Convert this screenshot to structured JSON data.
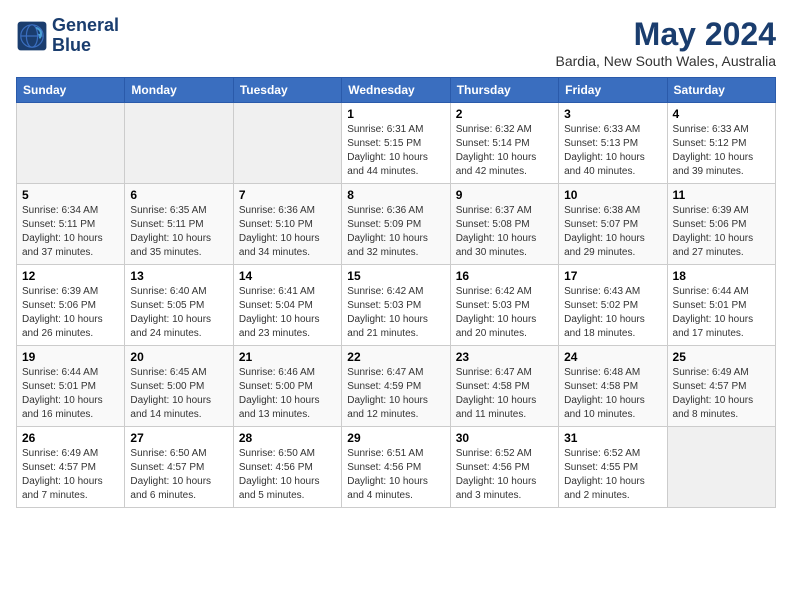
{
  "header": {
    "logo_line1": "General",
    "logo_line2": "Blue",
    "month_year": "May 2024",
    "location": "Bardia, New South Wales, Australia"
  },
  "days_of_week": [
    "Sunday",
    "Monday",
    "Tuesday",
    "Wednesday",
    "Thursday",
    "Friday",
    "Saturday"
  ],
  "weeks": [
    [
      {
        "num": "",
        "info": ""
      },
      {
        "num": "",
        "info": ""
      },
      {
        "num": "",
        "info": ""
      },
      {
        "num": "1",
        "info": "Sunrise: 6:31 AM\nSunset: 5:15 PM\nDaylight: 10 hours\nand 44 minutes."
      },
      {
        "num": "2",
        "info": "Sunrise: 6:32 AM\nSunset: 5:14 PM\nDaylight: 10 hours\nand 42 minutes."
      },
      {
        "num": "3",
        "info": "Sunrise: 6:33 AM\nSunset: 5:13 PM\nDaylight: 10 hours\nand 40 minutes."
      },
      {
        "num": "4",
        "info": "Sunrise: 6:33 AM\nSunset: 5:12 PM\nDaylight: 10 hours\nand 39 minutes."
      }
    ],
    [
      {
        "num": "5",
        "info": "Sunrise: 6:34 AM\nSunset: 5:11 PM\nDaylight: 10 hours\nand 37 minutes."
      },
      {
        "num": "6",
        "info": "Sunrise: 6:35 AM\nSunset: 5:11 PM\nDaylight: 10 hours\nand 35 minutes."
      },
      {
        "num": "7",
        "info": "Sunrise: 6:36 AM\nSunset: 5:10 PM\nDaylight: 10 hours\nand 34 minutes."
      },
      {
        "num": "8",
        "info": "Sunrise: 6:36 AM\nSunset: 5:09 PM\nDaylight: 10 hours\nand 32 minutes."
      },
      {
        "num": "9",
        "info": "Sunrise: 6:37 AM\nSunset: 5:08 PM\nDaylight: 10 hours\nand 30 minutes."
      },
      {
        "num": "10",
        "info": "Sunrise: 6:38 AM\nSunset: 5:07 PM\nDaylight: 10 hours\nand 29 minutes."
      },
      {
        "num": "11",
        "info": "Sunrise: 6:39 AM\nSunset: 5:06 PM\nDaylight: 10 hours\nand 27 minutes."
      }
    ],
    [
      {
        "num": "12",
        "info": "Sunrise: 6:39 AM\nSunset: 5:06 PM\nDaylight: 10 hours\nand 26 minutes."
      },
      {
        "num": "13",
        "info": "Sunrise: 6:40 AM\nSunset: 5:05 PM\nDaylight: 10 hours\nand 24 minutes."
      },
      {
        "num": "14",
        "info": "Sunrise: 6:41 AM\nSunset: 5:04 PM\nDaylight: 10 hours\nand 23 minutes."
      },
      {
        "num": "15",
        "info": "Sunrise: 6:42 AM\nSunset: 5:03 PM\nDaylight: 10 hours\nand 21 minutes."
      },
      {
        "num": "16",
        "info": "Sunrise: 6:42 AM\nSunset: 5:03 PM\nDaylight: 10 hours\nand 20 minutes."
      },
      {
        "num": "17",
        "info": "Sunrise: 6:43 AM\nSunset: 5:02 PM\nDaylight: 10 hours\nand 18 minutes."
      },
      {
        "num": "18",
        "info": "Sunrise: 6:44 AM\nSunset: 5:01 PM\nDaylight: 10 hours\nand 17 minutes."
      }
    ],
    [
      {
        "num": "19",
        "info": "Sunrise: 6:44 AM\nSunset: 5:01 PM\nDaylight: 10 hours\nand 16 minutes."
      },
      {
        "num": "20",
        "info": "Sunrise: 6:45 AM\nSunset: 5:00 PM\nDaylight: 10 hours\nand 14 minutes."
      },
      {
        "num": "21",
        "info": "Sunrise: 6:46 AM\nSunset: 5:00 PM\nDaylight: 10 hours\nand 13 minutes."
      },
      {
        "num": "22",
        "info": "Sunrise: 6:47 AM\nSunset: 4:59 PM\nDaylight: 10 hours\nand 12 minutes."
      },
      {
        "num": "23",
        "info": "Sunrise: 6:47 AM\nSunset: 4:58 PM\nDaylight: 10 hours\nand 11 minutes."
      },
      {
        "num": "24",
        "info": "Sunrise: 6:48 AM\nSunset: 4:58 PM\nDaylight: 10 hours\nand 10 minutes."
      },
      {
        "num": "25",
        "info": "Sunrise: 6:49 AM\nSunset: 4:57 PM\nDaylight: 10 hours\nand 8 minutes."
      }
    ],
    [
      {
        "num": "26",
        "info": "Sunrise: 6:49 AM\nSunset: 4:57 PM\nDaylight: 10 hours\nand 7 minutes."
      },
      {
        "num": "27",
        "info": "Sunrise: 6:50 AM\nSunset: 4:57 PM\nDaylight: 10 hours\nand 6 minutes."
      },
      {
        "num": "28",
        "info": "Sunrise: 6:50 AM\nSunset: 4:56 PM\nDaylight: 10 hours\nand 5 minutes."
      },
      {
        "num": "29",
        "info": "Sunrise: 6:51 AM\nSunset: 4:56 PM\nDaylight: 10 hours\nand 4 minutes."
      },
      {
        "num": "30",
        "info": "Sunrise: 6:52 AM\nSunset: 4:56 PM\nDaylight: 10 hours\nand 3 minutes."
      },
      {
        "num": "31",
        "info": "Sunrise: 6:52 AM\nSunset: 4:55 PM\nDaylight: 10 hours\nand 2 minutes."
      },
      {
        "num": "",
        "info": ""
      }
    ]
  ]
}
